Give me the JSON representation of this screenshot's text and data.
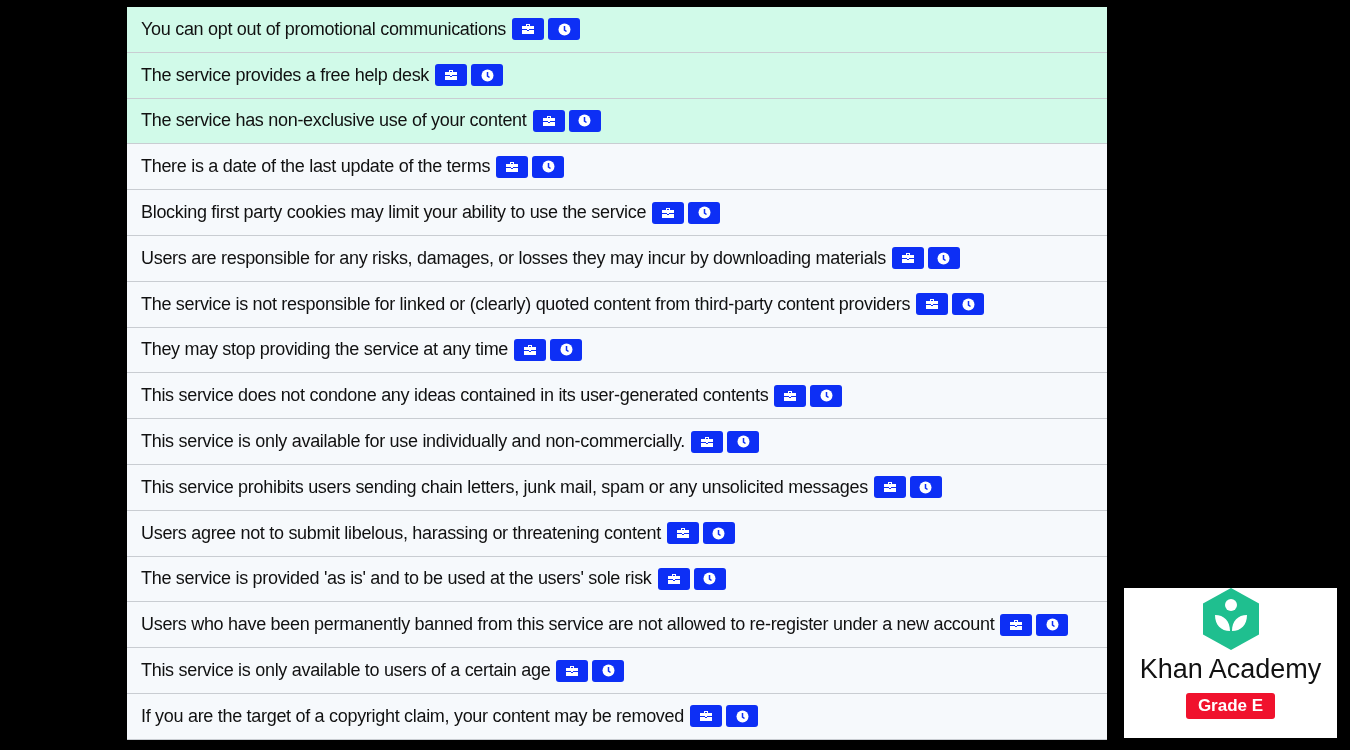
{
  "points": [
    {
      "text": "You can opt out of promotional communications",
      "kind": "good"
    },
    {
      "text": "The service provides a free help desk",
      "kind": "good"
    },
    {
      "text": "The service has non-exclusive use of your content",
      "kind": "good"
    },
    {
      "text": "There is a date of the last update of the terms",
      "kind": "neutral"
    },
    {
      "text": "Blocking first party cookies may limit your ability to use the service",
      "kind": "neutral"
    },
    {
      "text": "Users are responsible for any risks, damages, or losses they may incur by downloading materials",
      "kind": "neutral"
    },
    {
      "text": "The service is not responsible for linked or (clearly) quoted content from third-party content providers",
      "kind": "neutral"
    },
    {
      "text": "They may stop providing the service at any time",
      "kind": "neutral"
    },
    {
      "text": "This service does not condone any ideas contained in its user-generated contents",
      "kind": "neutral"
    },
    {
      "text": "This service is only available for use individually and non-commercially.",
      "kind": "neutral"
    },
    {
      "text": "This service prohibits users sending chain letters, junk mail, spam or any unsolicited messages",
      "kind": "neutral"
    },
    {
      "text": "Users agree not to submit libelous, harassing or threatening content",
      "kind": "neutral"
    },
    {
      "text": "The service is provided 'as is' and to be used at the users' sole risk",
      "kind": "neutral"
    },
    {
      "text": "Users who have been permanently banned from this service are not allowed to re-register under a new account",
      "kind": "neutral"
    },
    {
      "text": "This service is only available to users of a certain age",
      "kind": "neutral"
    },
    {
      "text": "If you are the target of a copyright claim, your content may be removed",
      "kind": "neutral"
    }
  ],
  "service": {
    "name": "Khan Academy",
    "grade": "Grade E"
  }
}
